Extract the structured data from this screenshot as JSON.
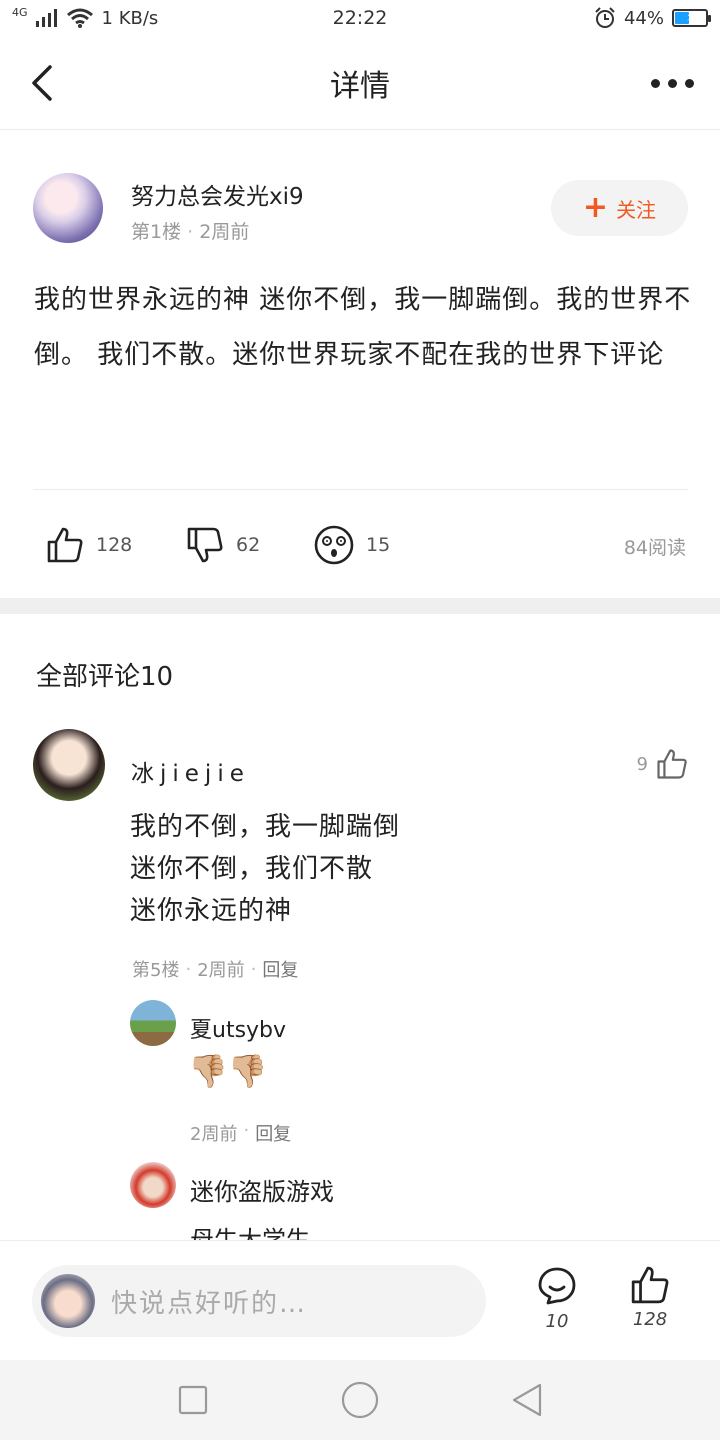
{
  "status_bar": {
    "network": "4G",
    "speed": "1 KB/s",
    "time": "22:22",
    "battery": "44%",
    "battery_level": 0.44
  },
  "header": {
    "title": "详情"
  },
  "post": {
    "author": "努力总会发光xi9",
    "floor": "第1楼",
    "time": "2周前",
    "follow_label": "关注",
    "text": "我的世界永远的神 迷你不倒，我一脚踹倒。我的世界不倒。 我们不散。迷你世界玩家不配在我的世界下评论",
    "likes": "128",
    "dislikes": "62",
    "emoji_count": "15",
    "reads": "84阅读"
  },
  "comments": {
    "title": "全部评论10",
    "items": [
      {
        "name": "冰jiejie",
        "likes": "9",
        "lines": [
          "我的不倒，我一脚踹倒",
          "迷你不倒，我们不散",
          "迷你永远的神"
        ],
        "floor": "第5楼",
        "time": "2周前",
        "reply_label": "回复",
        "replies": [
          {
            "name": "夏utsybv",
            "text": "👎🏼👎🏼",
            "time": "2周前",
            "reply_label": "回复"
          },
          {
            "name": "迷你盗版游戏",
            "text": "母牛大学生"
          }
        ]
      }
    ]
  },
  "bottom_bar": {
    "placeholder": "快说点好听的…",
    "comment_count": "10",
    "like_count": "128"
  },
  "colors": {
    "accent": "#f05a22",
    "divider": "#ececec",
    "muted_text": "#999999"
  }
}
